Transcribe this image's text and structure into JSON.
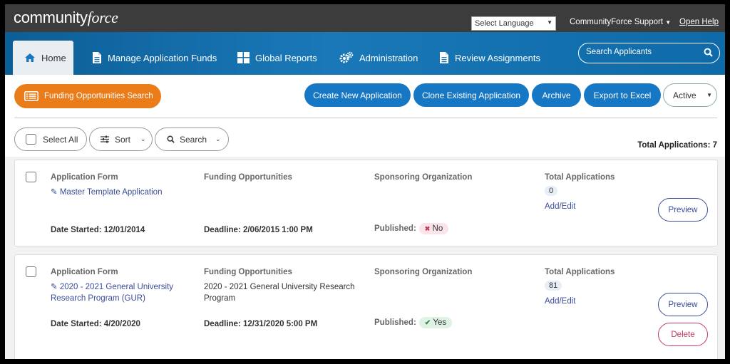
{
  "header": {
    "logo_part1": "community",
    "logo_part2": "force",
    "language_select": "Select Language",
    "support_label": "CommunityForce Support",
    "help_label": "Open Help"
  },
  "nav": {
    "tabs": [
      {
        "label": "Home",
        "icon": "home-icon"
      },
      {
        "label": "Manage Application Funds",
        "icon": "document-icon"
      },
      {
        "label": "Global Reports",
        "icon": "grid-icon"
      },
      {
        "label": "Administration",
        "icon": "gears-icon"
      },
      {
        "label": "Review Assignments",
        "icon": "document-icon"
      }
    ],
    "search_placeholder": "Search Applicants"
  },
  "toolbar": {
    "funding_search": "Funding Opportunities Search",
    "create": "Create New Application",
    "clone": "Clone Existing Application",
    "archive": "Archive",
    "export": "Export to Excel",
    "status_filter": "Active"
  },
  "filters": {
    "select_all": "Select All",
    "sort": "Sort",
    "search": "Search",
    "total_label": "Total Applications: 7"
  },
  "columns": {
    "app_form": "Application Form",
    "funding": "Funding Opportunities",
    "sponsor": "Sponsoring Organization",
    "total": "Total Applications"
  },
  "applications": [
    {
      "form_name": "Master Template Application",
      "funding": "",
      "total": "0",
      "add_edit": "Add/Edit",
      "date_started": "Date Started: 12/01/2014",
      "deadline": "Deadline: 2/06/2015 1:00 PM",
      "published_label": "Published:",
      "published": "No",
      "preview": "Preview"
    },
    {
      "form_name_line1": "2020 - 2021 General University",
      "form_name_line2": "Research Program (GUR)",
      "funding_line1": "2020 - 2021 General University Research",
      "funding_line2": "Program",
      "total": "81",
      "add_edit": "Add/Edit",
      "date_started": "Date Started: 4/20/2020",
      "deadline": "Deadline: 12/31/2020 5:00 PM",
      "published_label": "Published:",
      "published": "Yes",
      "preview": "Preview",
      "delete": "Delete"
    }
  ],
  "colors": {
    "topbar": "#3c3c3c",
    "nav": "#1a78b8",
    "orange": "#ea7d1a",
    "blue_button": "#1677c4",
    "link": "#3a4c9a",
    "delete": "#c23a5c"
  }
}
